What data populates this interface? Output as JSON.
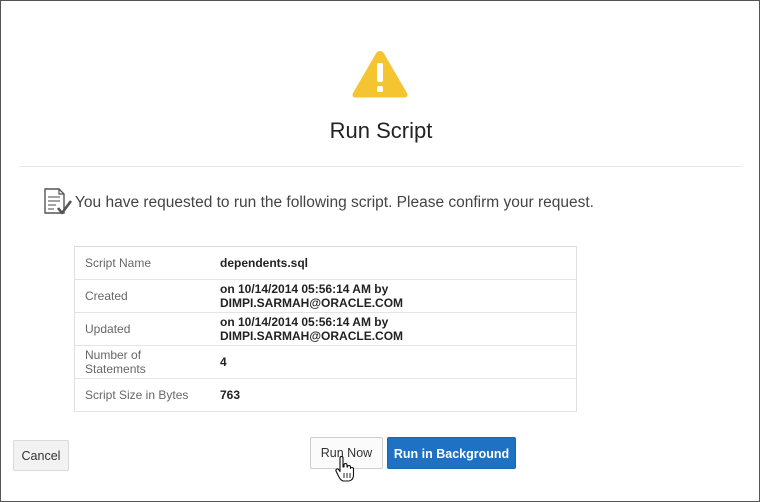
{
  "dialog": {
    "title": "Run Script",
    "message": "You have requested to run the following script. Please confirm your request."
  },
  "details": [
    {
      "label": "Script Name",
      "value": "dependents.sql"
    },
    {
      "label": "Created",
      "value": "on 10/14/2014 05:56:14 AM by DIMPI.SARMAH@ORACLE.COM"
    },
    {
      "label": "Updated",
      "value": "on 10/14/2014 05:56:14 AM by DIMPI.SARMAH@ORACLE.COM"
    },
    {
      "label": "Number of Statements",
      "value": "4"
    },
    {
      "label": "Script Size in Bytes",
      "value": "763"
    }
  ],
  "buttons": {
    "cancel": "Cancel",
    "run_now": "Run Now",
    "run_in_background": "Run in Background"
  },
  "colors": {
    "warning": "#f5c431",
    "primary": "#1f72c3"
  },
  "icons": [
    "warning-icon",
    "script-check-icon",
    "hand-cursor-icon"
  ]
}
